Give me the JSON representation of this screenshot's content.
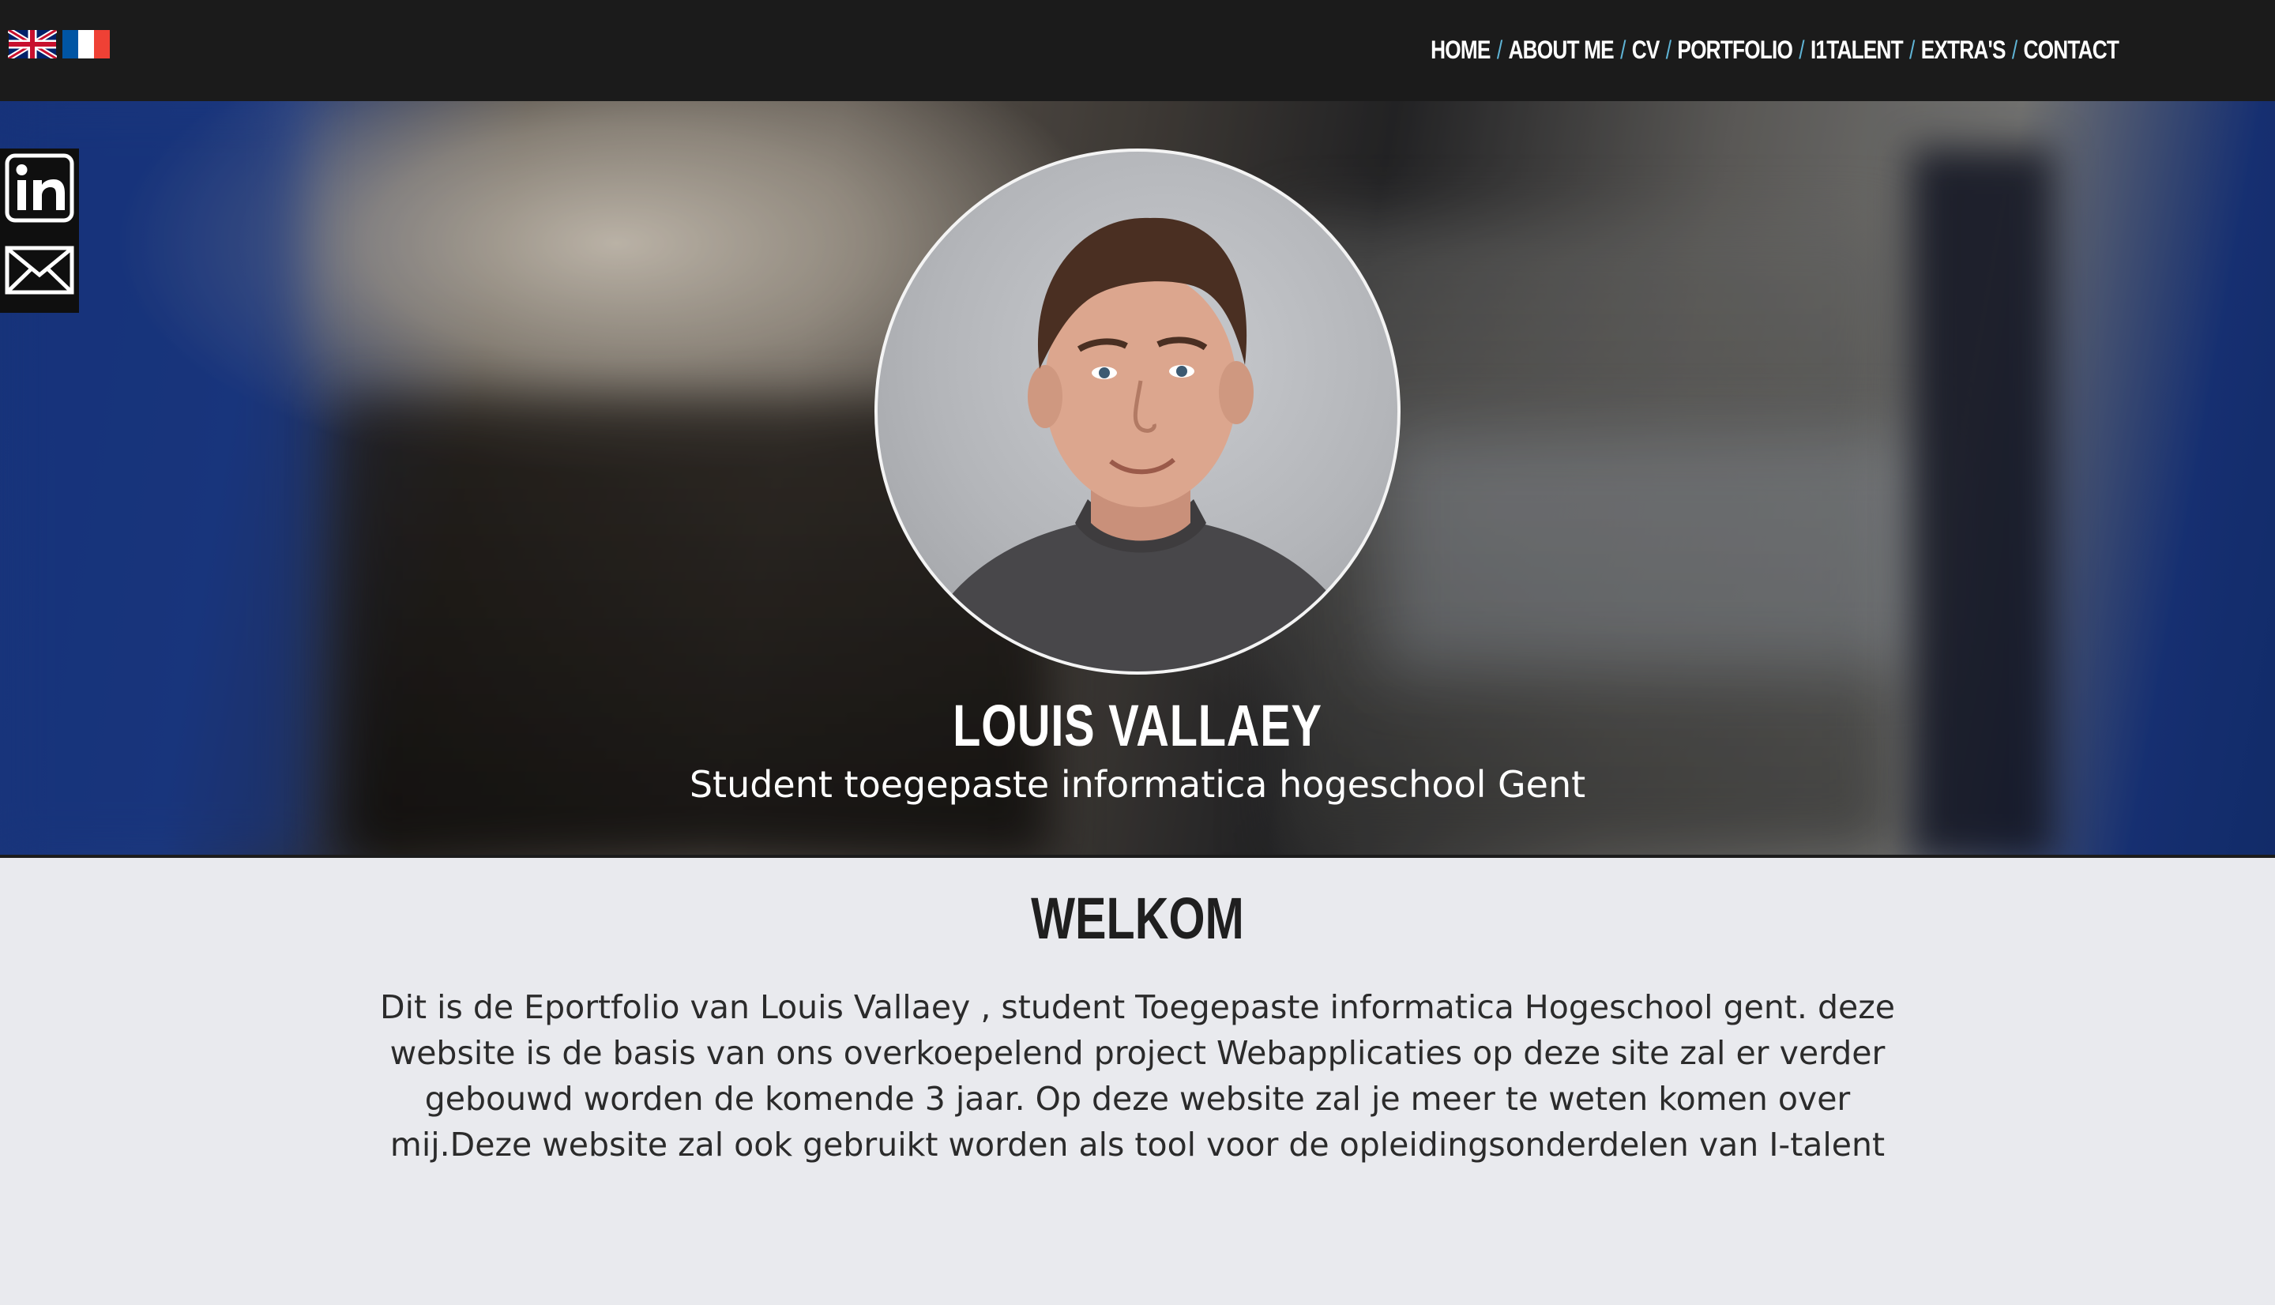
{
  "header": {
    "languages": [
      {
        "icon": "uk-flag-icon",
        "colors": [
          "#012169",
          "#ffffff",
          "#c8102e"
        ]
      },
      {
        "icon": "french-flag-icon",
        "colors": [
          "#0055a4",
          "#ffffff",
          "#ef4135"
        ]
      }
    ],
    "nav": {
      "home": "HOME",
      "about": "ABOUT ME",
      "cv": "CV",
      "portfolio": "PORTFOLIO",
      "i1talent": "I1TALENT",
      "extras": "EXTRA'S",
      "contact": "CONTACT",
      "separator": "/"
    }
  },
  "social": {
    "items": [
      {
        "icon": "linkedin-icon"
      },
      {
        "icon": "mail-icon"
      }
    ]
  },
  "hero": {
    "name": "LOUIS VALLAEY",
    "subtitle": "Student toegepaste informatica hogeschool Gent"
  },
  "welcome": {
    "title": "WELKOM",
    "text": "Dit is de Eportfolio van Louis Vallaey , student Toegepaste informatica Hogeschool gent. deze website is de basis van ons overkoepelend project Webapplicaties op deze site zal er verder gebouwd worden de komende 3 jaar. Op deze website zal je meer te weten komen over mij.Deze website zal ook gebruikt worden als tool voor de opleidingsonderdelen van I-talent"
  },
  "colors": {
    "topbar": "#1b1b1b",
    "nav_separator": "#5fb4d6",
    "section_bg": "#e9eaee",
    "text_dark": "#2b2b2b"
  }
}
